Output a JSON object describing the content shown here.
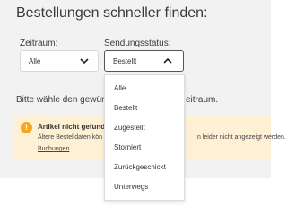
{
  "heading": "Bestellungen schneller finden:",
  "period": {
    "label": "Zeitraum:",
    "value": "Alle"
  },
  "status": {
    "label": "Sendungsstatus:",
    "value": "Bestellt",
    "options": [
      "Alle",
      "Bestellt",
      "Zugestellt",
      "Storniert",
      "Zurückgeschickt",
      "Unterwegs"
    ]
  },
  "hint": {
    "visible_start": "Bitte wähle den gewüns",
    "visible_end": "eitraum."
  },
  "banner": {
    "icon": "warning-icon",
    "title": "Artikel nicht gefunden?",
    "line_start": "Ältere Bestelldaten kön",
    "line_end": "n leider nicht angezeigt werden.",
    "link": "Buchungen",
    "link_suffix": "."
  },
  "colors": {
    "panel_background": "#f2f2f2",
    "banner_background": "#fdf0d5",
    "warning_accent": "#f5a623"
  }
}
